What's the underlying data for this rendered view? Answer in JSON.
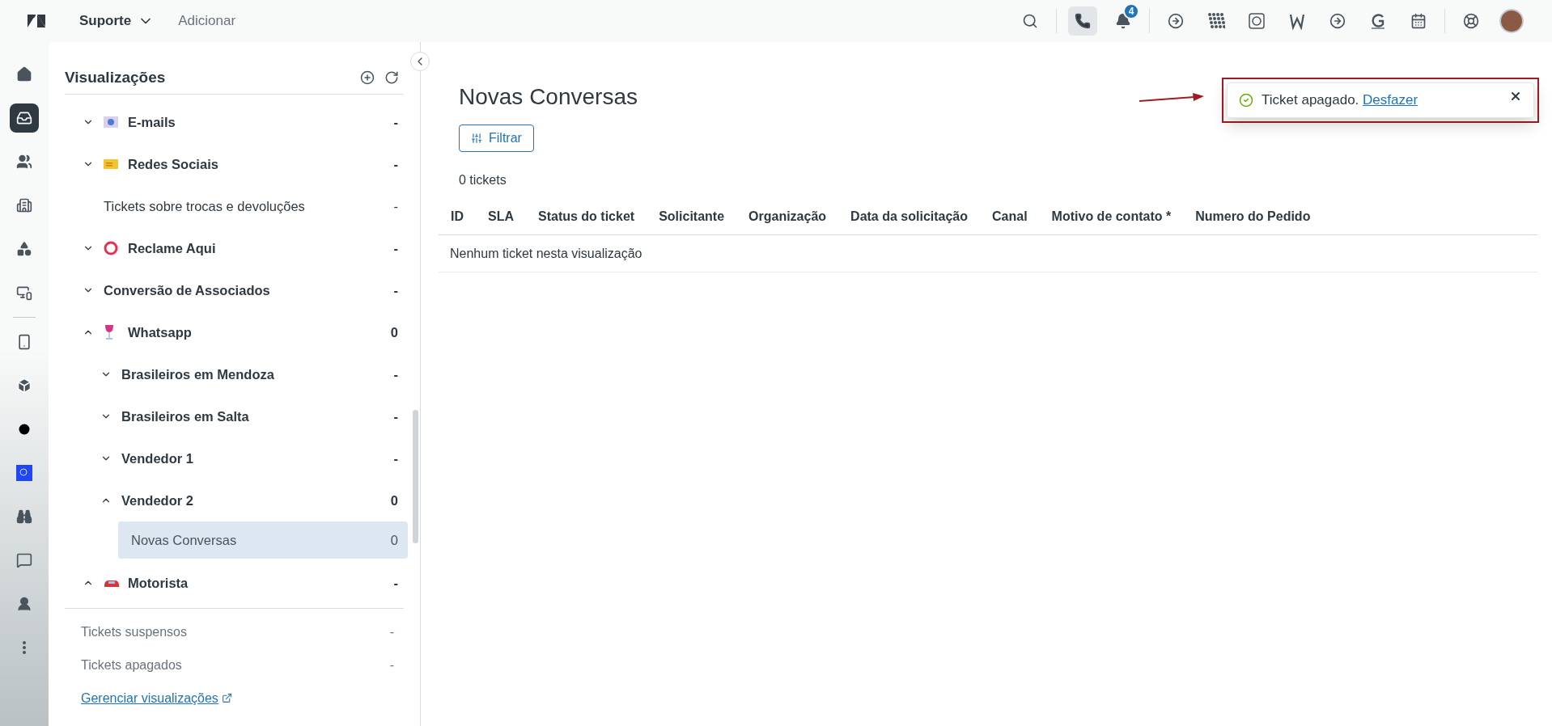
{
  "top_bar": {
    "product": "Suporte",
    "add_label": "Adicionar",
    "toolbar_groups": [
      [
        {
          "kind": "search",
          "selected": false
        }
      ],
      [
        {
          "kind": "phone",
          "selected": true
        },
        {
          "kind": "bell",
          "selected": false,
          "badge": "4"
        }
      ],
      [
        {
          "kind": "circle-arrow",
          "selected": false
        },
        {
          "kind": "grid-pattern",
          "selected": false
        },
        {
          "kind": "chat-square",
          "selected": false
        },
        {
          "kind": "zigzag",
          "selected": false
        },
        {
          "kind": "circle-arrow",
          "selected": false
        },
        {
          "kind": "g-mark",
          "selected": false
        },
        {
          "kind": "calendar",
          "selected": false
        }
      ],
      [
        {
          "kind": "lifebuoy",
          "selected": false
        },
        {
          "kind": "avatar",
          "selected": false
        }
      ]
    ]
  },
  "rail": [
    {
      "kind": "home",
      "selected": false
    },
    {
      "kind": "inbox",
      "selected": true
    },
    {
      "kind": "users",
      "selected": false
    },
    {
      "kind": "building",
      "selected": false
    },
    {
      "kind": "shapes",
      "selected": false
    },
    {
      "kind": "devices",
      "selected": false
    },
    {
      "kind": "divider"
    },
    {
      "kind": "phone-transfer",
      "selected": false
    },
    {
      "kind": "cube",
      "selected": false
    },
    {
      "kind": "dot",
      "selected": false
    },
    {
      "kind": "app-tile",
      "selected": false
    },
    {
      "kind": "binoculars",
      "selected": false
    },
    {
      "kind": "chat",
      "selected": false
    },
    {
      "kind": "person",
      "selected": false
    },
    {
      "kind": "more",
      "selected": false
    }
  ],
  "sidebar": {
    "title": "Visualizações",
    "views": [
      {
        "label": "E-mails",
        "count": "-",
        "kind": "envelope",
        "expanded": false,
        "selected": false
      },
      {
        "label": "Redes Sociais",
        "count": "-",
        "kind": "ticket",
        "expanded": false,
        "selected": false
      },
      {
        "label": "Tickets sobre trocas e devoluções",
        "count": "-",
        "selected": false
      },
      {
        "label": "Reclame Aqui",
        "count": "-",
        "kind": "ring",
        "expanded": false,
        "selected": false
      },
      {
        "label": "Conversão de Associados",
        "count": "-",
        "expanded": false,
        "selected": false
      },
      {
        "label": "Whatsapp",
        "count": "0",
        "kind": "glass",
        "expanded": true,
        "selected": false,
        "children": [
          {
            "label": "Brasileiros em Mendoza",
            "count": "-",
            "expanded": false,
            "selected": false
          },
          {
            "label": "Brasileiros em Salta",
            "count": "-",
            "expanded": false,
            "selected": false
          },
          {
            "label": "Vendedor 1",
            "count": "-",
            "expanded": false,
            "selected": false
          },
          {
            "label": "Vendedor 2",
            "count": "0",
            "expanded": true,
            "selected": false,
            "children": [
              {
                "label": "Novas Conversas",
                "count": "0",
                "selected": true
              }
            ]
          }
        ]
      },
      {
        "label": "Motorista",
        "count": "-",
        "kind": "car",
        "expanded": true,
        "selected": false
      }
    ],
    "extra_views": [
      {
        "label": "Tickets suspensos",
        "count": "-"
      },
      {
        "label": "Tickets apagados",
        "count": "-"
      }
    ],
    "manage_link": "Gerenciar visualizações"
  },
  "main": {
    "title": "Novas Conversas",
    "filter_button": "Filtrar",
    "ticket_count": "0 tickets",
    "table": {
      "columns": [
        "ID",
        "SLA",
        "Status do ticket",
        "Solicitante",
        "Organização",
        "Data da solicitação",
        "Canal",
        "Motivo de contato *",
        "Numero do Pedido"
      ],
      "empty_message": "Nenhum ticket nesta visualização"
    }
  },
  "toast": {
    "message": "Ticket apagado.",
    "action": "Desfazer"
  }
}
